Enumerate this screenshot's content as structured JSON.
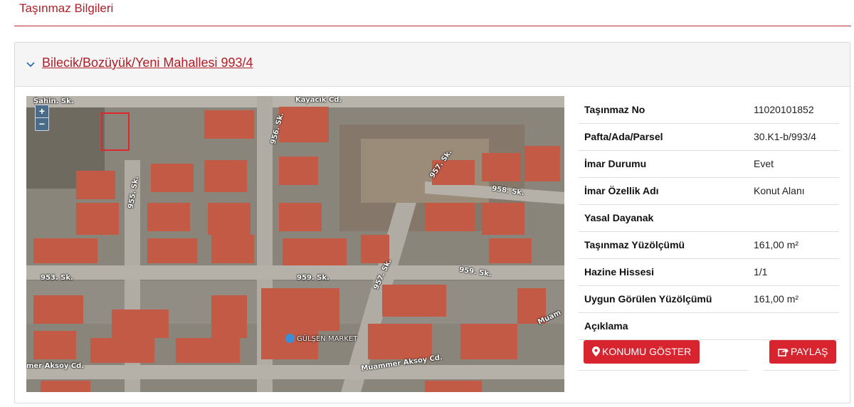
{
  "page": {
    "title": "Taşınmaz Bilgileri"
  },
  "parcel": {
    "link_text": "Bilecik/Bozüyük/Yeni Mahallesi 993/4"
  },
  "map": {
    "zoom_in": "+",
    "zoom_out": "−",
    "street_labels": [
      "Şahin. Sk.",
      "Kayacık Cd.",
      "956. Sk.",
      "957. Sk.",
      "958. Sk.",
      "955. Sk.",
      "953. Sk.",
      "959. Sk.",
      "959. Sk.",
      "957. Sk.",
      "Muammer Aksoy Cd.",
      "mer Aksoy Cd.",
      "Muam",
      "GÜLŞEN MARKET"
    ]
  },
  "details": [
    {
      "key": "Taşınmaz No",
      "value": "11020101852"
    },
    {
      "key": "Pafta/Ada/Parsel",
      "value": "30.K1-b/993/4"
    },
    {
      "key": "İmar Durumu",
      "value": "Evet"
    },
    {
      "key": "İmar Özellik Adı",
      "value": "Konut Alanı"
    },
    {
      "key": "Yasal Dayanak",
      "value": ""
    },
    {
      "key": "Taşınmaz Yüzölçümü",
      "value": "161,00 m²"
    },
    {
      "key": "Hazine Hissesi",
      "value": "1/1"
    },
    {
      "key": "Uygun Görülen Yüzölçümü",
      "value": "161,00 m²"
    },
    {
      "key": "Açıklama",
      "value": ""
    }
  ],
  "buttons": {
    "show_location": "KONUMU GÖSTER",
    "share": "PAYLAŞ"
  },
  "colors": {
    "accent": "#d8242f",
    "title": "#b0202a"
  }
}
